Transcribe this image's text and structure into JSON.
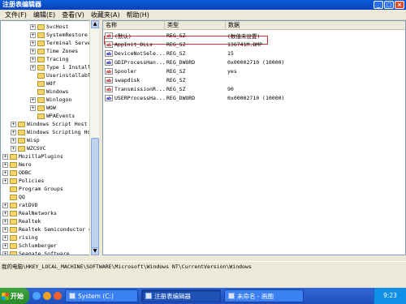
{
  "window": {
    "title": "注册表编辑器",
    "buttons": [
      "_",
      "□",
      "×"
    ]
  },
  "menu": [
    "文件(F)",
    "编辑(E)",
    "查看(V)",
    "收藏夹(A)",
    "帮助(H)"
  ],
  "tree": [
    {
      "label": "SvcHost",
      "level": 3,
      "exp": "+"
    },
    {
      "label": "SystemRestore",
      "level": 3,
      "exp": "+"
    },
    {
      "label": "Terminal Serve",
      "level": 3,
      "exp": "+"
    },
    {
      "label": "Time Zones",
      "level": 3,
      "exp": "+"
    },
    {
      "label": "Tracing",
      "level": 3,
      "exp": "+"
    },
    {
      "label": "Type 1 Install",
      "level": 3,
      "exp": "+"
    },
    {
      "label": "Userinstallabl",
      "level": 3,
      "exp": ""
    },
    {
      "label": "Wdf",
      "level": 3,
      "exp": ""
    },
    {
      "label": "Windows",
      "level": 3,
      "exp": ""
    },
    {
      "label": "Winlogon",
      "level": 3,
      "exp": "+"
    },
    {
      "label": "WOW",
      "level": 3,
      "exp": "+"
    },
    {
      "label": "WPAEvents",
      "level": 3,
      "exp": ""
    },
    {
      "label": "Windows Script Host",
      "level": 2,
      "exp": "+"
    },
    {
      "label": "Windows Scripting Ho",
      "level": 2,
      "exp": "+"
    },
    {
      "label": "Wisp",
      "level": 2,
      "exp": "+"
    },
    {
      "label": "WZCSVC",
      "level": 2,
      "exp": "+"
    },
    {
      "label": "MozillaPlugins",
      "level": 1,
      "exp": "+"
    },
    {
      "label": "Nero",
      "level": 1,
      "exp": "+"
    },
    {
      "label": "ODBC",
      "level": 1,
      "exp": "+"
    },
    {
      "label": "Policies",
      "level": 1,
      "exp": "+"
    },
    {
      "label": "Program Groups",
      "level": 1,
      "exp": ""
    },
    {
      "label": "QQ",
      "level": 1,
      "exp": ""
    },
    {
      "label": "ratDVD",
      "level": 1,
      "exp": "+"
    },
    {
      "label": "RealNetworks",
      "level": 1,
      "exp": "+"
    },
    {
      "label": "Realtek",
      "level": 1,
      "exp": "+"
    },
    {
      "label": "Realtek Semiconductor C",
      "level": 1,
      "exp": "+"
    },
    {
      "label": "rising",
      "level": 1,
      "exp": "+"
    },
    {
      "label": "Schlumberger",
      "level": 1,
      "exp": "+"
    },
    {
      "label": "Seagate Software",
      "level": 1,
      "exp": "+"
    }
  ],
  "columns": [
    "名称",
    "类型",
    "数据"
  ],
  "values": [
    {
      "icon": "ab",
      "kind": "sz",
      "name": "(默认)",
      "type": "REG_SZ",
      "data": "(数值未设置)"
    },
    {
      "icon": "ab",
      "kind": "sz",
      "name": "AppInit_DLLs",
      "type": "REG_SZ",
      "data": "136741M.BMP"
    },
    {
      "icon": "ab",
      "kind": "dword",
      "name": "DeviceNotSele...",
      "type": "REG_SZ",
      "data": "15"
    },
    {
      "icon": "ab",
      "kind": "dword",
      "name": "GDIProcessHan...",
      "type": "REG_DWORD",
      "data": "0x00002710 (10000)"
    },
    {
      "icon": "ab",
      "kind": "sz",
      "name": "Spooler",
      "type": "REG_SZ",
      "data": "yes"
    },
    {
      "icon": "ab",
      "kind": "sz",
      "name": "swapdisk",
      "type": "REG_SZ",
      "data": ""
    },
    {
      "icon": "ab",
      "kind": "sz",
      "name": "TransmissionR...",
      "type": "REG_SZ",
      "data": "90"
    },
    {
      "icon": "ab",
      "kind": "dword",
      "name": "USERProcessHa...",
      "type": "REG_DWORD",
      "data": "0x00002710 (10000)"
    }
  ],
  "status": "我的电脑\\HKEY_LOCAL_MACHINE\\SOFTWARE\\Microsoft\\Windows NT\\CurrentVersion\\Windows",
  "taskbar": {
    "start": "开始",
    "tasks": [
      {
        "label": "System (C:)",
        "active": false
      },
      {
        "label": "注册表编辑器",
        "active": true
      },
      {
        "label": "未命名 - 画图",
        "active": false
      }
    ],
    "clock": "9:23"
  },
  "colors": {
    "titlebar": "#0842b8",
    "highlight": "#d03030",
    "taskbar": "#1e4fbc"
  }
}
